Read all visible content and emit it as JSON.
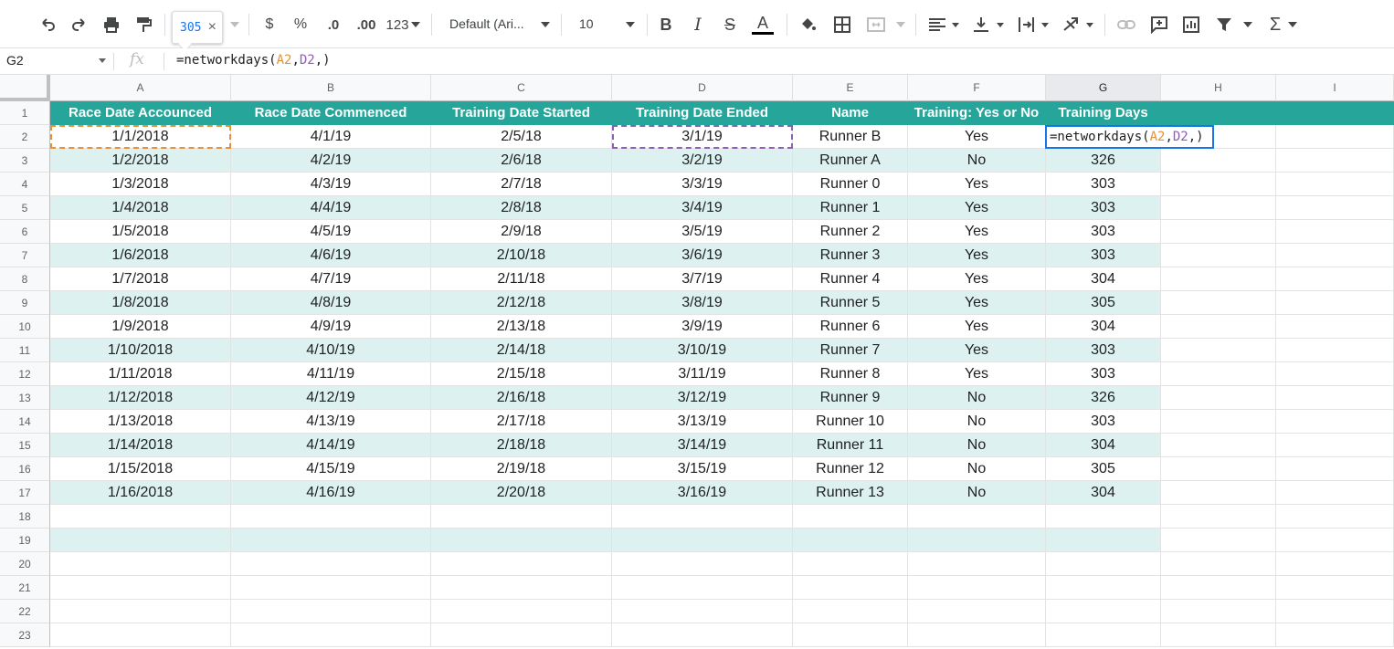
{
  "toolbar": {
    "icons": [
      "undo-icon",
      "redo-icon",
      "print-icon",
      "paint-format-icon",
      "currency-icon",
      "percent-icon",
      "decrease-decimal-icon",
      "increase-decimal-icon",
      "more-formats-icon",
      "bold-icon",
      "italic-icon",
      "strikethrough-icon",
      "text-color-icon",
      "fill-color-icon",
      "borders-icon",
      "merge-cells-icon",
      "horizontal-align-icon",
      "vertical-align-icon",
      "text-wrapping-icon",
      "text-rotation-icon",
      "link-icon",
      "comment-icon",
      "chart-icon",
      "filter-icon",
      "functions-icon"
    ],
    "currency_label": "$",
    "percent_label": "%",
    "decrease_decimal_label": ".0",
    "increase_decimal_label": ".00",
    "more_formats_label": "123",
    "font_name": "Default (Ari...",
    "font_size": "10",
    "bold_label": "B",
    "italic_label": "I",
    "strike_label": "S",
    "text_color_label": "A",
    "functions_label": "Σ",
    "tooltip_value": "305",
    "tooltip_close": "×"
  },
  "formula_bar": {
    "name_box": "G2",
    "fx_label": "fx",
    "formula_prefix": "=networkdays(",
    "formula_ref_a": "A2",
    "formula_comma1": ",",
    "formula_ref_d": "D2",
    "formula_suffix": ",)"
  },
  "columns": [
    "A",
    "B",
    "C",
    "D",
    "E",
    "F",
    "G",
    "H",
    "I"
  ],
  "row_numbers": [
    "1",
    "2",
    "3",
    "4",
    "5",
    "6",
    "7",
    "8",
    "9",
    "10",
    "11",
    "12",
    "13",
    "14",
    "15",
    "16",
    "17",
    "18",
    "19",
    "20",
    "21",
    "22",
    "23"
  ],
  "sheet": {
    "headers": [
      "Race Date Accounced",
      "Race Date Commenced",
      "Training Date Started",
      "Training Date Ended",
      "Name",
      "Training: Yes or No",
      "Training Days"
    ],
    "rows": [
      [
        "1/1/2018",
        "4/1/19",
        "2/5/18",
        "3/1/19",
        "Runner B",
        "Yes",
        ""
      ],
      [
        "1/2/2018",
        "4/2/19",
        "2/6/18",
        "3/2/19",
        "Runner A",
        "No",
        "326"
      ],
      [
        "1/3/2018",
        "4/3/19",
        "2/7/18",
        "3/3/19",
        "Runner 0",
        "Yes",
        "303"
      ],
      [
        "1/4/2018",
        "4/4/19",
        "2/8/18",
        "3/4/19",
        "Runner 1",
        "Yes",
        "303"
      ],
      [
        "1/5/2018",
        "4/5/19",
        "2/9/18",
        "3/5/19",
        "Runner 2",
        "Yes",
        "303"
      ],
      [
        "1/6/2018",
        "4/6/19",
        "2/10/18",
        "3/6/19",
        "Runner 3",
        "Yes",
        "303"
      ],
      [
        "1/7/2018",
        "4/7/19",
        "2/11/18",
        "3/7/19",
        "Runner 4",
        "Yes",
        "304"
      ],
      [
        "1/8/2018",
        "4/8/19",
        "2/12/18",
        "3/8/19",
        "Runner 5",
        "Yes",
        "305"
      ],
      [
        "1/9/2018",
        "4/9/19",
        "2/13/18",
        "3/9/19",
        "Runner 6",
        "Yes",
        "304"
      ],
      [
        "1/10/2018",
        "4/10/19",
        "2/14/18",
        "3/10/19",
        "Runner 7",
        "Yes",
        "303"
      ],
      [
        "1/11/2018",
        "4/11/19",
        "2/15/18",
        "3/11/19",
        "Runner 8",
        "Yes",
        "303"
      ],
      [
        "1/12/2018",
        "4/12/19",
        "2/16/18",
        "3/12/19",
        "Runner 9",
        "No",
        "326"
      ],
      [
        "1/13/2018",
        "4/13/19",
        "2/17/18",
        "3/13/19",
        "Runner 10",
        "No",
        "303"
      ],
      [
        "1/14/2018",
        "4/14/19",
        "2/18/18",
        "3/14/19",
        "Runner 11",
        "No",
        "304"
      ],
      [
        "1/15/2018",
        "4/15/19",
        "2/19/18",
        "3/15/19",
        "Runner 12",
        "No",
        "305"
      ],
      [
        "1/16/2018",
        "4/16/19",
        "2/20/18",
        "3/16/19",
        "Runner 13",
        "No",
        "304"
      ]
    ]
  },
  "active_cell": "G2",
  "colors": {
    "header_fill": "#26a69a",
    "band_fill": "#ddf2f0",
    "selection": "#1a73e8",
    "ref_a": "#e69138",
    "ref_d": "#8e5fb0"
  }
}
